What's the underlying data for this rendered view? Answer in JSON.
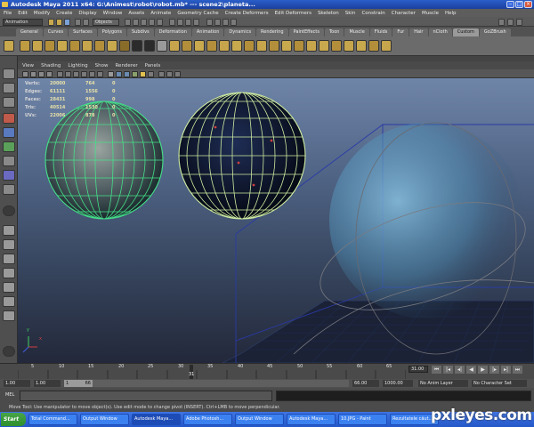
{
  "window": {
    "title": "Autodesk Maya 2011 x64: G:\\Animest\\robot\\robot.mb* --- scene2\\planeta...",
    "icon": "maya-app-icon"
  },
  "menubar": [
    "File",
    "Edit",
    "Modify",
    "Create",
    "Display",
    "Window",
    "Assets",
    "Animate",
    "Geometry Cache",
    "Create Deformers",
    "Edit Deformers",
    "Skeleton",
    "Skin",
    "Constrain",
    "Character",
    "Muscle",
    "Help"
  ],
  "statusline": {
    "mode": "Animation",
    "objects_label": "Objects"
  },
  "shelf": {
    "tabs": [
      "General",
      "Curves",
      "Surfaces",
      "Polygons",
      "Subdivs",
      "Deformation",
      "Animation",
      "Dynamics",
      "Rendering",
      "PaintEffects",
      "Toon",
      "Muscle",
      "Fluids",
      "Fur",
      "Hair",
      "nCloth",
      "Custom",
      "GoZBrush"
    ],
    "active_tab": "Custom"
  },
  "panel_menu": [
    "View",
    "Shading",
    "Lighting",
    "Show",
    "Renderer",
    "Panels"
  ],
  "hud": {
    "rows": [
      {
        "label": "Verts:",
        "v1": "20000",
        "v2": "764",
        "v3": "0"
      },
      {
        "label": "Edges:",
        "v1": "61111",
        "v2": "1556",
        "v3": "0"
      },
      {
        "label": "Faces:",
        "v1": "28431",
        "v2": "998",
        "v3": "0"
      },
      {
        "label": "Tris:",
        "v1": "40514",
        "v2": "1530",
        "v3": "0"
      },
      {
        "label": "UVs:",
        "v1": "22006",
        "v2": "878",
        "v3": "0"
      }
    ]
  },
  "axis_labels": {
    "x": "x",
    "y": "y"
  },
  "time_slider": {
    "ticks": [
      "5",
      "10",
      "15",
      "20",
      "25",
      "30",
      "35",
      "40",
      "45",
      "50",
      "55",
      "60",
      "65"
    ],
    "current_frame": "31",
    "frame_field": "31.00"
  },
  "range": {
    "start": "1.00",
    "start_playback": "1.00",
    "range_box_start": "1",
    "range_box_end": "66",
    "end_playback": "66.00",
    "end": "1000.00",
    "anim_layer": "No Anim Layer",
    "character_set": "No Character Set"
  },
  "command": {
    "label": "MEL"
  },
  "helpline": "Move Tool: Use manipulator to move object(s). Use edit mode to change pivot (INSERT). Ctrl+LMB to move perpendicular.",
  "taskbar": {
    "start": "Start",
    "tasks": [
      "Total Command...",
      "Output Window",
      "Autodesk Maya...",
      "Adobe Photosh...",
      "Output Window",
      "Autodesk Maya...",
      "10.JPG - Paint",
      "Rezultatele căut..."
    ],
    "active_index": 2
  },
  "watermark": "pxleyes.com"
}
